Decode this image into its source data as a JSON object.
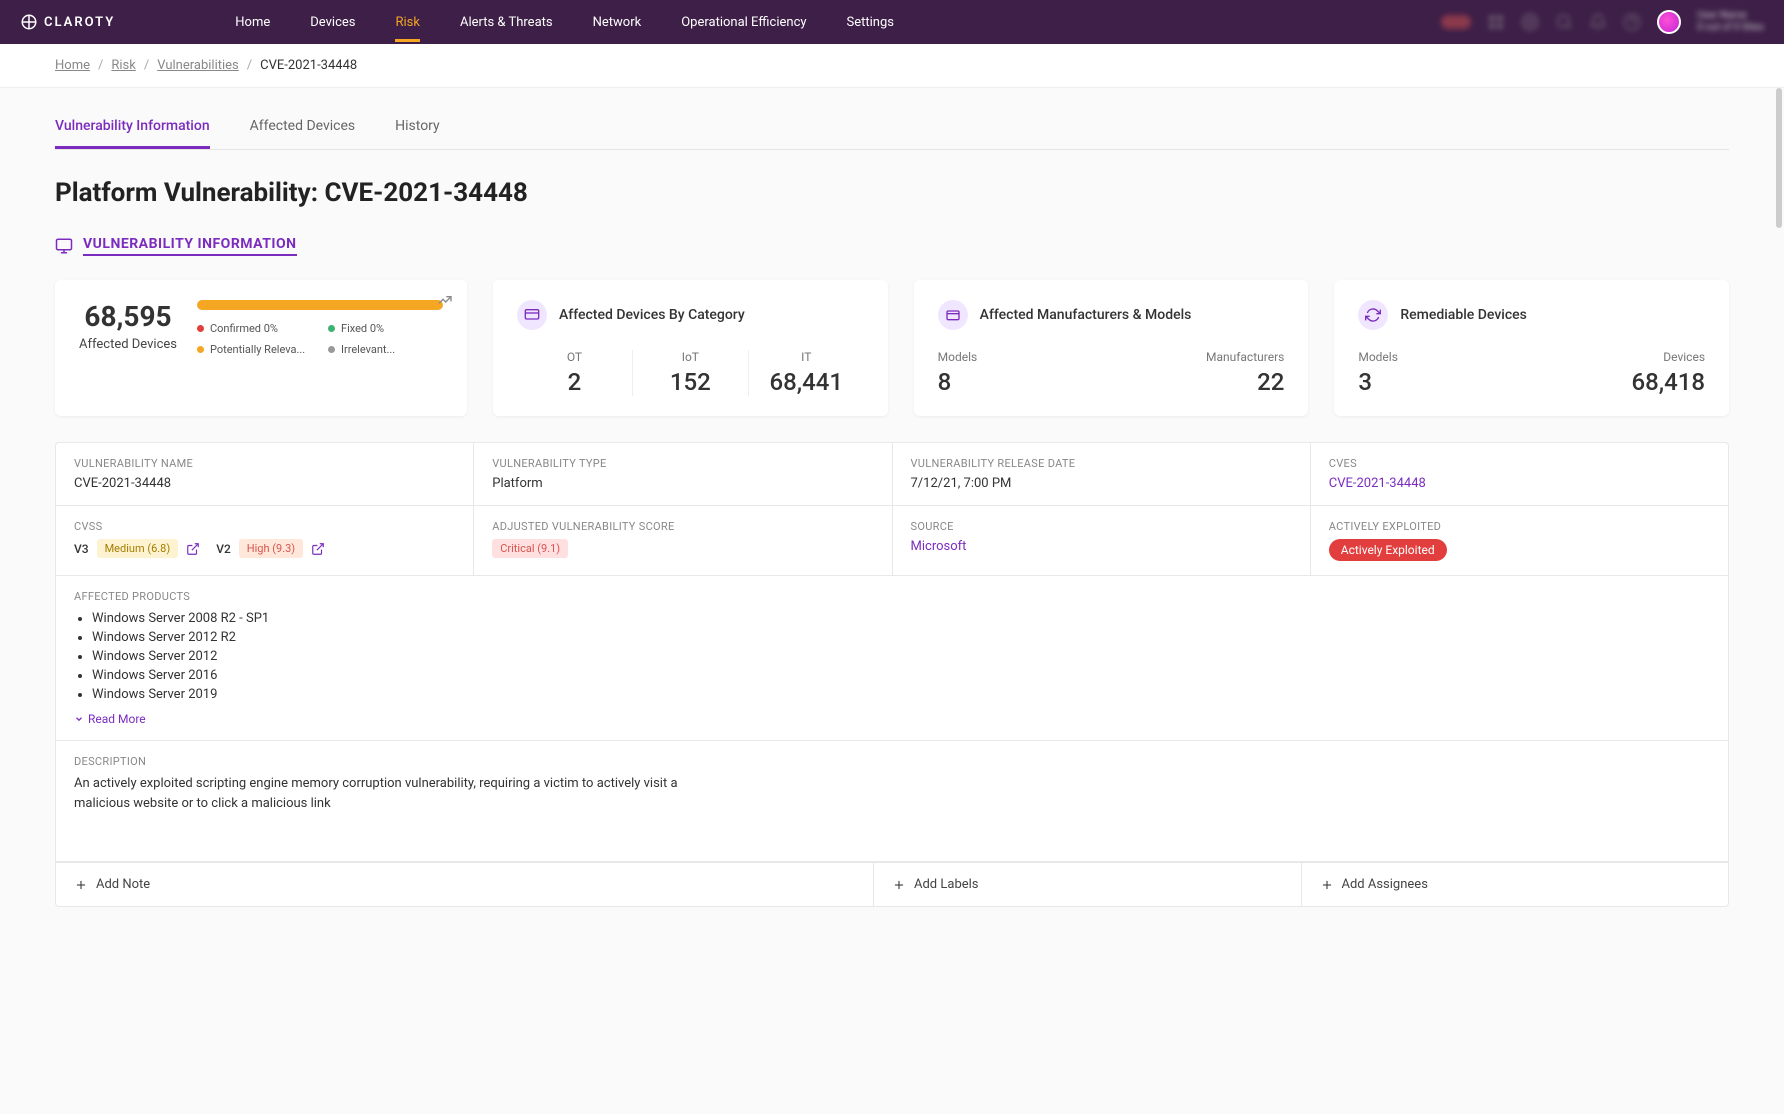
{
  "brand": "CLAROTY",
  "nav": {
    "items": [
      {
        "label": "Home",
        "active": false
      },
      {
        "label": "Devices",
        "active": false
      },
      {
        "label": "Risk",
        "active": true
      },
      {
        "label": "Alerts & Threats",
        "active": false
      },
      {
        "label": "Network",
        "active": false
      },
      {
        "label": "Operational Efficiency",
        "active": false
      },
      {
        "label": "Settings",
        "active": false
      }
    ]
  },
  "breadcrumb": {
    "items": [
      "Home",
      "Risk",
      "Vulnerabilities"
    ],
    "current": "CVE-2021-34448"
  },
  "tabs": [
    {
      "label": "Vulnerability Information",
      "active": true
    },
    {
      "label": "Affected Devices",
      "active": false
    },
    {
      "label": "History",
      "active": false
    }
  ],
  "page_title": "Platform Vulnerability: CVE-2021-34448",
  "section_label": "VULNERABILITY INFORMATION",
  "cards": {
    "affected": {
      "count": "68,595",
      "label": "Affected Devices",
      "legend": [
        {
          "color": "#e33e3e",
          "text": "Confirmed 0%"
        },
        {
          "color": "#3cb371",
          "text": "Fixed 0%"
        },
        {
          "color": "#f5a623",
          "text": "Potentially Releva..."
        },
        {
          "color": "#999",
          "text": "Irrelevant..."
        }
      ]
    },
    "category": {
      "title": "Affected Devices By Category",
      "stats": [
        {
          "label": "OT",
          "value": "2"
        },
        {
          "label": "IoT",
          "value": "152"
        },
        {
          "label": "IT",
          "value": "68,441"
        }
      ]
    },
    "manufacturers": {
      "title": "Affected Manufacturers & Models",
      "models_label": "Models",
      "models_value": "8",
      "manuf_label": "Manufacturers",
      "manuf_value": "22"
    },
    "remediable": {
      "title": "Remediable Devices",
      "models_label": "Models",
      "models_value": "3",
      "devices_label": "Devices",
      "devices_value": "68,418"
    }
  },
  "details": {
    "name_label": "VULNERABILITY NAME",
    "name_value": "CVE-2021-34448",
    "type_label": "VULNERABILITY TYPE",
    "type_value": "Platform",
    "date_label": "VULNERABILITY RELEASE DATE",
    "date_value": "7/12/21, 7:00 PM",
    "cves_label": "CVES",
    "cves_value": "CVE-2021-34448",
    "cvss_label": "CVSS",
    "v3_label": "V3",
    "v3_badge": "Medium (6.8)",
    "v2_label": "V2",
    "v2_badge": "High (9.3)",
    "avs_label": "ADJUSTED VULNERABILITY SCORE",
    "avs_badge": "Critical (9.1)",
    "source_label": "SOURCE",
    "source_value": "Microsoft",
    "exploited_label": "ACTIVELY EXPLOITED",
    "exploited_badge": "Actively Exploited",
    "products_label": "AFFECTED PRODUCTS",
    "products": [
      "Windows Server 2008 R2 - SP1",
      "Windows Server 2012 R2",
      "Windows Server 2012",
      "Windows Server 2016",
      "Windows Server 2019"
    ],
    "readmore": "Read More",
    "desc_label": "DESCRIPTION",
    "desc_value": "An actively exploited scripting engine memory corruption vulnerability, requiring a victim to actively visit a malicious website or to click a malicious link"
  },
  "actions": {
    "note": "Add Note",
    "labels": "Add Labels",
    "assignees": "Add Assignees"
  }
}
